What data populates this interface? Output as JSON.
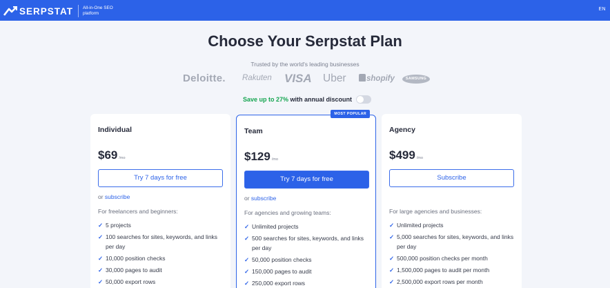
{
  "header": {
    "logo_text": "SERPSTAT",
    "tagline": "All-in-One SEO platform",
    "lang": "EN",
    "accent": "#2c62e8"
  },
  "hero": {
    "title": "Choose Your Serpstat Plan",
    "trusted": "Trusted by the world's leading businesses"
  },
  "brands": [
    "Deloitte.",
    "Rakuten",
    "VISA",
    "Uber",
    "shopify",
    "SAMSUNG"
  ],
  "discount": {
    "prefix": "Save up to 27%",
    "suffix": " with annual discount",
    "enabled": false
  },
  "plans": [
    {
      "name": "Individual",
      "price": "$69",
      "per": "/mo",
      "button": "Try 7 days for free",
      "or_text": "or ",
      "or_link": "subscribe",
      "desc": "For freelancers and beginners:",
      "features": [
        "5 projects",
        "100 searches for sites, keywords, and links per day",
        "10,000 position checks",
        "30,000 pages to audit",
        "50,000 export rows"
      ]
    },
    {
      "name": "Team",
      "badge": "MOST POPULAR",
      "price": "$129",
      "per": "/mo",
      "button": "Try 7 days for free",
      "or_text": "or ",
      "or_link": "subscribe",
      "desc": "For agencies and growing teams:",
      "features": [
        "Unlimited projects",
        "500 searches for sites, keywords, and links per day",
        "50,000 position checks",
        "150,000 pages to audit",
        "250,000 export rows"
      ]
    },
    {
      "name": "Agency",
      "price": "$499",
      "per": "/mo",
      "button": "Subscribe",
      "desc": "For large agencies and businesses:",
      "features": [
        "Unlimited projects",
        "5,000 searches for sites, keywords, and links per day",
        "500,000 position checks per month",
        "1,500,000 pages to audit per month",
        "2,500,000 export rows per month"
      ]
    }
  ]
}
